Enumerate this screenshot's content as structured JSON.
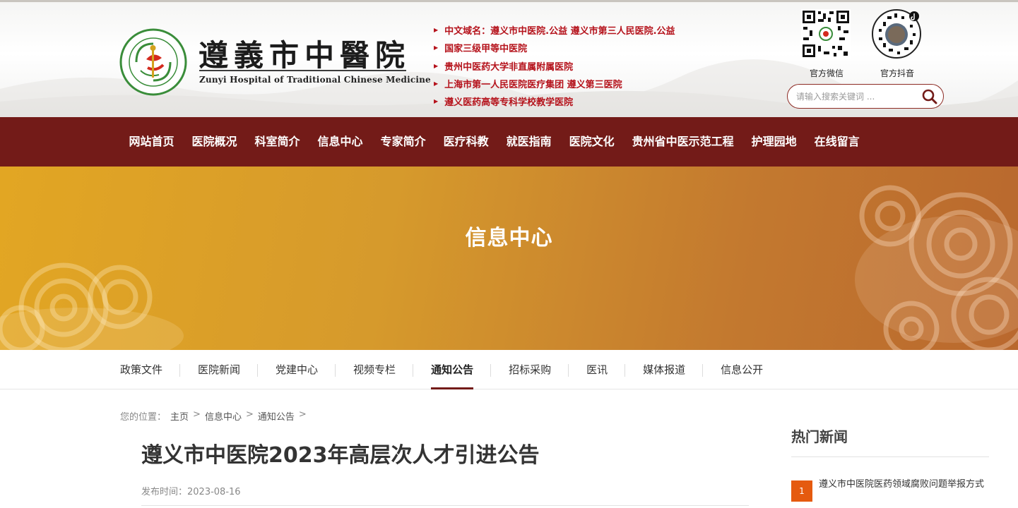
{
  "header": {
    "logo_title": "遵義市中醫院",
    "logo_subtitle": "Zunyi Hospital of Traditional Chinese Medicine",
    "claims": [
      "中文域名：遵义市中医院.公益 遵义市第三人民医院.公益",
      "国家三级甲等中医院",
      "贵州中医药大学非直属附属医院",
      "上海市第一人民医院医疗集团 遵义第三医院",
      "遵义医药高等专科学校教学医院"
    ],
    "qr_wechat_label": "官方微信",
    "qr_douyin_label": "官方抖音",
    "search_placeholder": "请输入搜索关键词 ..."
  },
  "nav": {
    "items": [
      "网站首页",
      "医院概况",
      "科室简介",
      "信息中心",
      "专家简介",
      "医疗科教",
      "就医指南",
      "医院文化",
      "贵州省中医示范工程",
      "护理园地",
      "在线留言"
    ]
  },
  "banner": {
    "title": "信息中心"
  },
  "subnav": {
    "items": [
      "政策文件",
      "医院新闻",
      "党建中心",
      "视频专栏",
      "通知公告",
      "招标采购",
      "医讯",
      "媒体报道",
      "信息公开"
    ],
    "active_index": 4
  },
  "breadcrumb": {
    "label": "您的位置：",
    "items": [
      "主页",
      "信息中心",
      "通知公告"
    ],
    "separator": ">"
  },
  "article": {
    "title": "遵义市中医院2023年高层次人才引进公告",
    "publish_time": "发布时间：2023-08-16"
  },
  "sidebar": {
    "hot_title": "热门新闻",
    "hot_items": [
      {
        "rank": "1",
        "text": "遵义市中医院医药领域腐败问题举报方式"
      }
    ]
  },
  "colors": {
    "nav_bg": "#731b18",
    "claim_red": "#b5121b",
    "rank_orange": "#e55a0f",
    "banner_gold": "#e2a623"
  }
}
